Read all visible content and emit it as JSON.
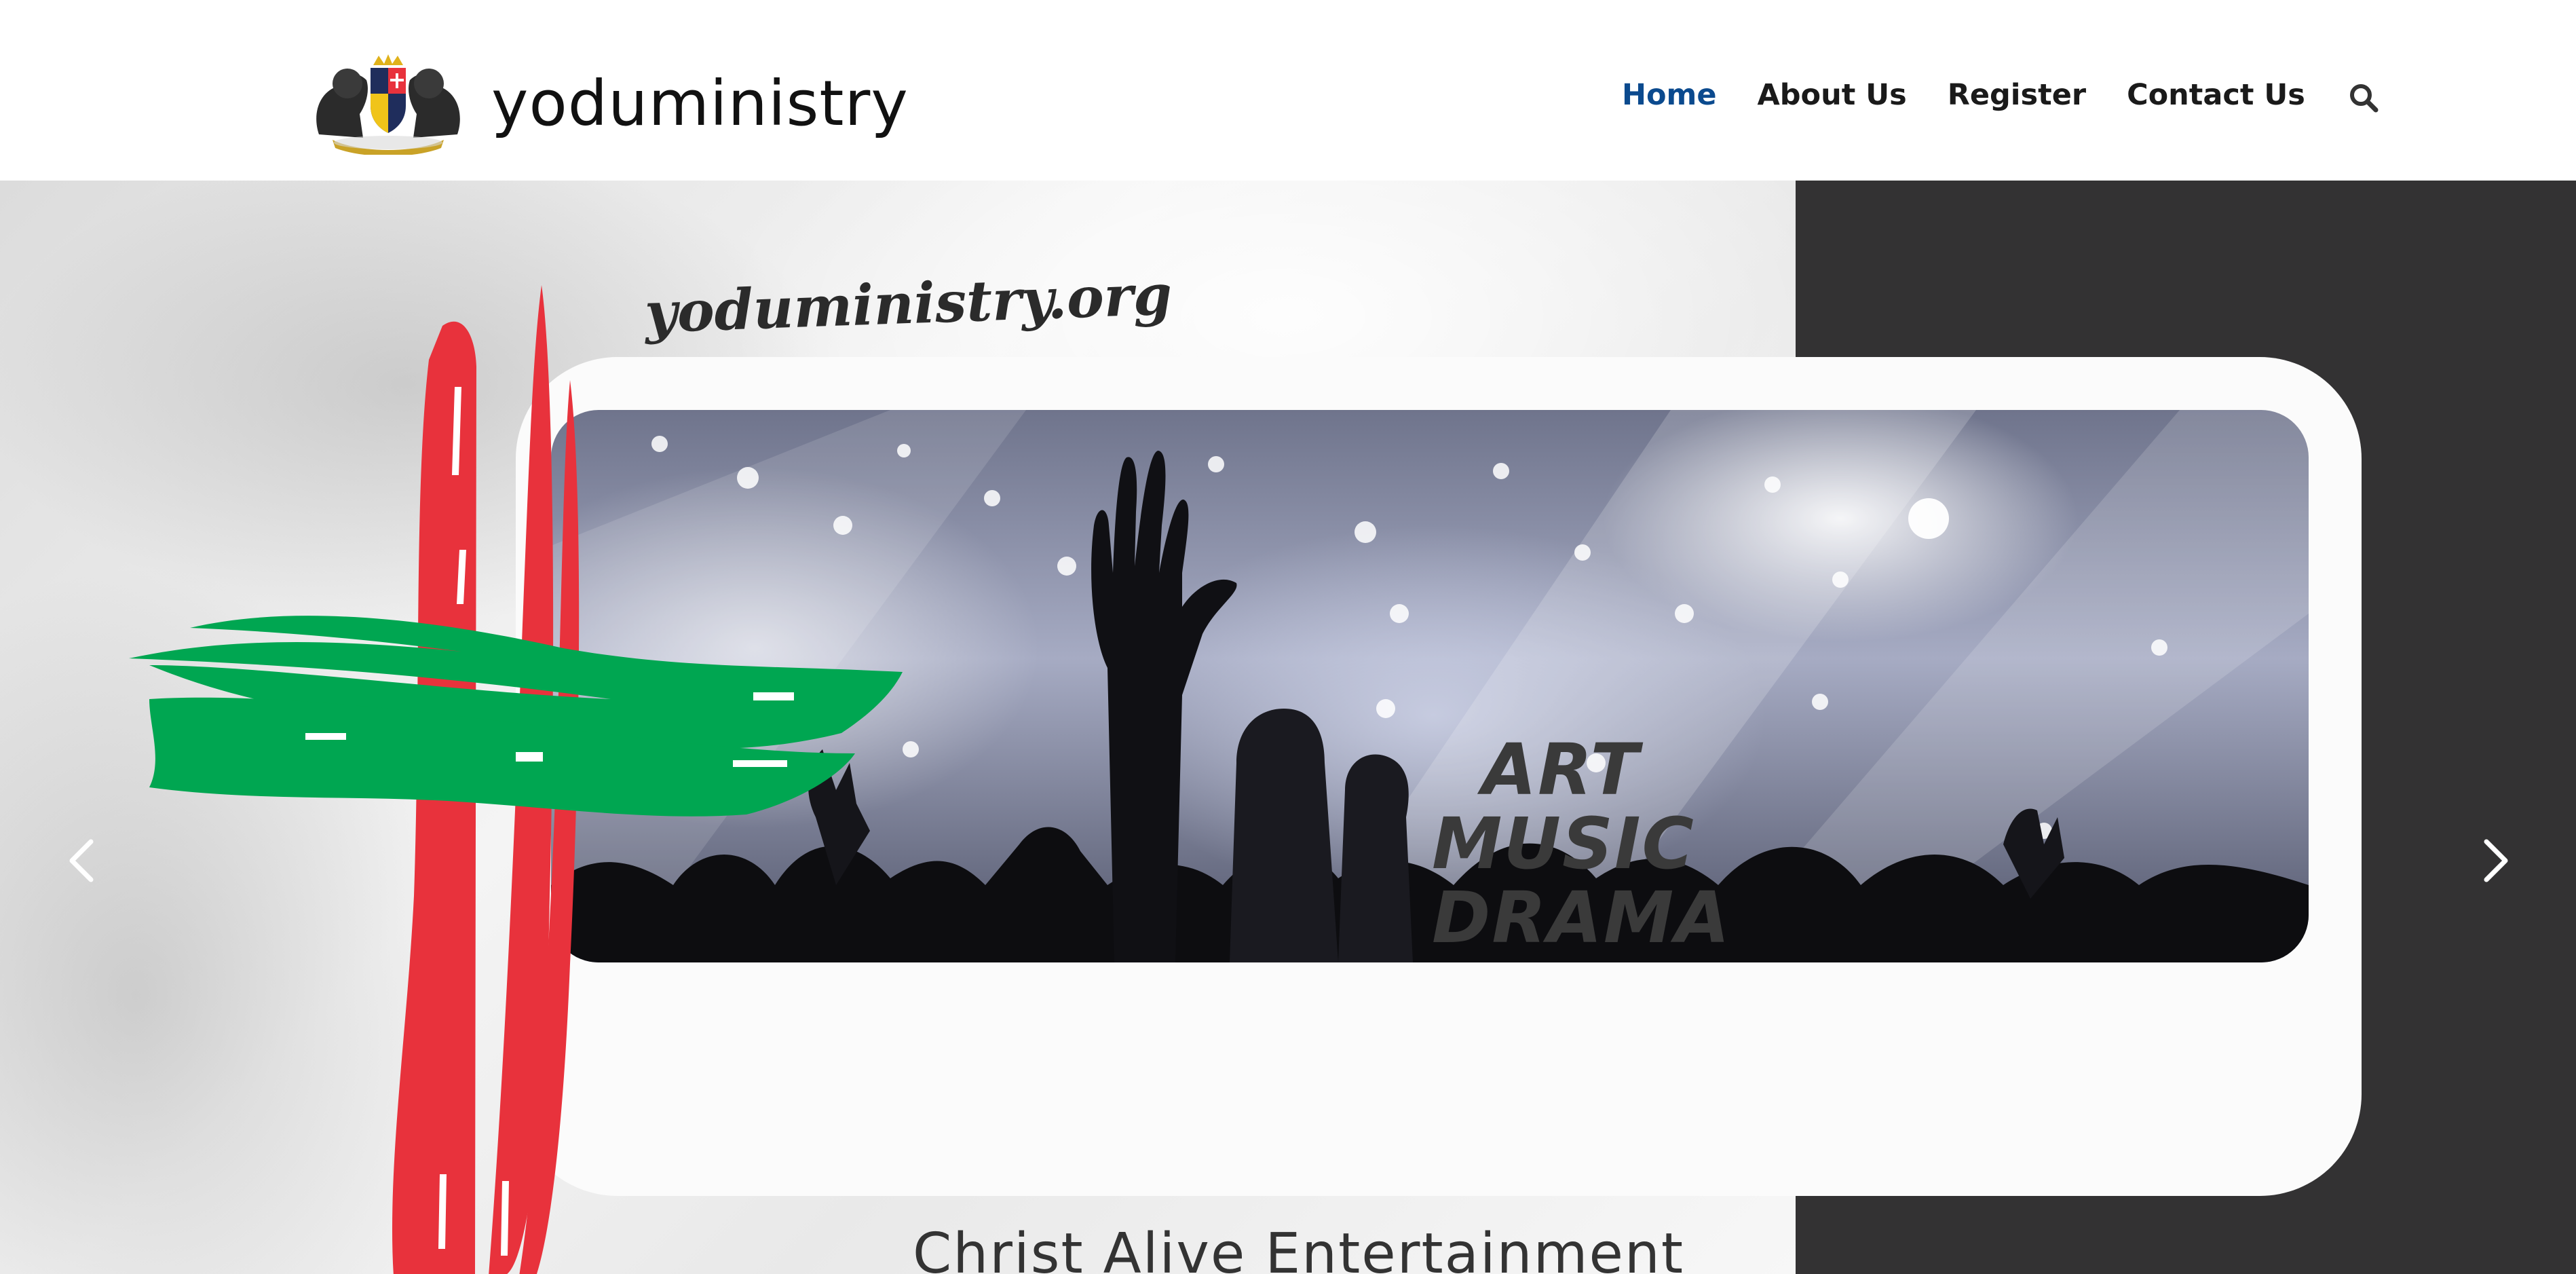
{
  "header": {
    "brand_name": "yoduministry",
    "logo_icon": "lion-crest-logo",
    "nav": [
      {
        "label": "Home",
        "active": true
      },
      {
        "label": "About Us",
        "active": false
      },
      {
        "label": "Register",
        "active": false
      },
      {
        "label": "Contact Us",
        "active": false
      }
    ],
    "search_icon": "search-icon"
  },
  "hero": {
    "site_url": "yoduministry.org",
    "banner_lines": [
      "ART",
      "MUSIC",
      "DRAMA"
    ],
    "subtitle": "Christ Alive Entertainment",
    "prev_icon": "chevron-left-icon",
    "next_icon": "chevron-right-icon"
  },
  "colors": {
    "active_nav": "#0b4a8e",
    "cross_red": "#e8323c",
    "cross_green": "#00a651",
    "dark_panel": "#333233"
  }
}
